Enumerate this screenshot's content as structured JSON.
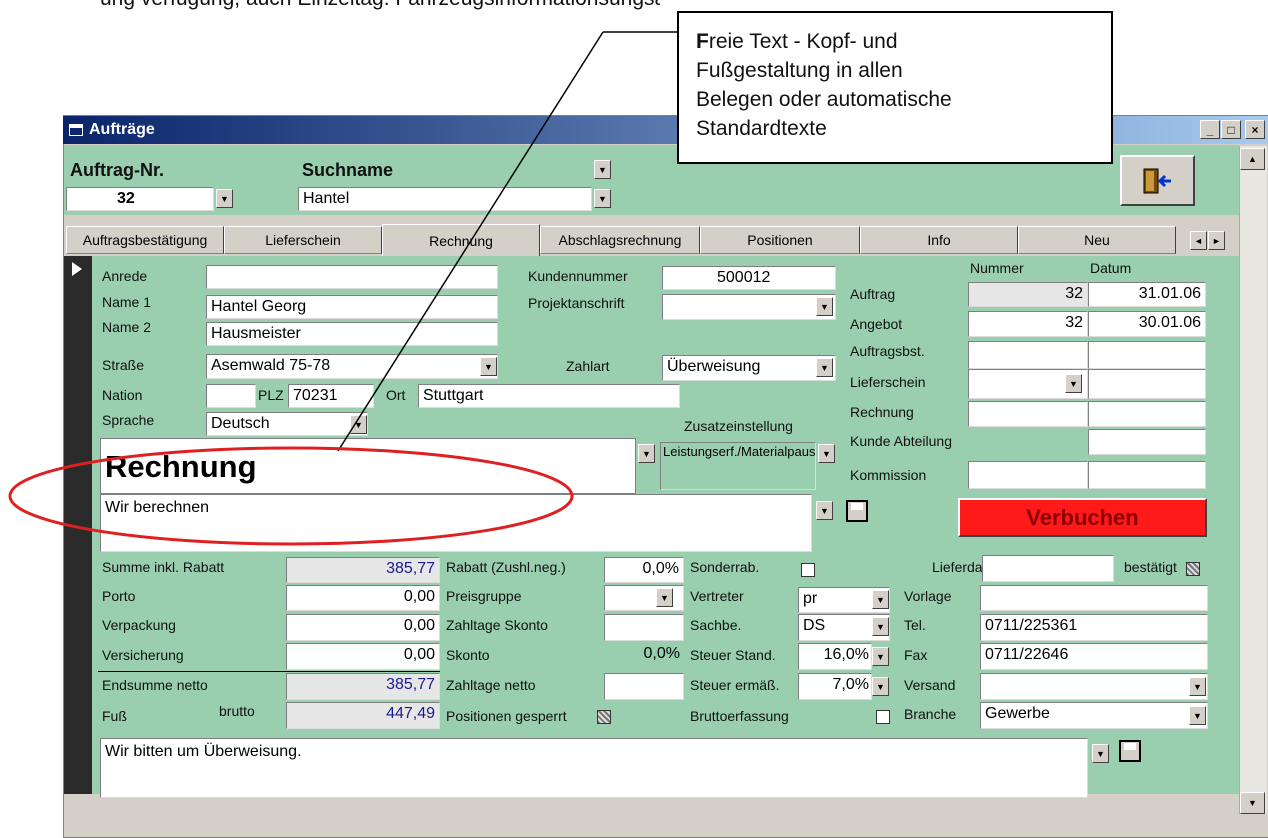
{
  "top_text": "ung verfügung, auch Einzeltag. Fahrzeugsinformationsungsaber.",
  "callout": {
    "first_letter": "F",
    "line1": "reie Text - Kopf- und",
    "line2": "Fußgestaltung in allen",
    "line3": "Belegen oder automatische",
    "line4": "Standardtexte"
  },
  "window": {
    "title": "Aufträge",
    "min": "_",
    "max": "□",
    "close": "×",
    "exit_icon": "exit-door-icon"
  },
  "header": {
    "order_label": "Auftrag-Nr.",
    "order_value": "32",
    "search_label": "Suchname",
    "search_value": "Hantel"
  },
  "tabs": [
    "Auftragsbestätigung",
    "Lieferschein",
    "Rechnung",
    "Abschlagsrechnung",
    "Positionen",
    "Info",
    "Neu"
  ],
  "tab_nav": {
    "left": "◄",
    "right": "►"
  },
  "customer": {
    "anrede_label": "Anrede",
    "anrede_value": "",
    "name1_label": "Name 1",
    "name1_value": "Hantel Georg",
    "name2_label": "Name 2",
    "name2_value": "Hausmeister",
    "strasse_label": "Straße",
    "strasse_value": "Asemwald 75-78",
    "nation_label": "Nation",
    "nation_value": "",
    "plz_label": "PLZ",
    "plz_value": "70231",
    "ort_label": "Ort",
    "ort_value": "Stuttgart",
    "sprache_label": "Sprache",
    "sprache_value": "Deutsch"
  },
  "middle": {
    "kundennummer_label": "Kundennummer",
    "kundennummer_value": "500012",
    "projekt_label": "Projektanschrift",
    "projekt_value": "",
    "zahlart_label": "Zahlart",
    "zahlart_value": "Überweisung",
    "zusatz_label": "Zusatzeinstellung",
    "zusatz_value": "Leistungserf./Materialpauschalverbuchung"
  },
  "docs": {
    "nummer_header": "Nummer",
    "datum_header": "Datum",
    "rows": [
      {
        "label": "Auftrag",
        "nummer": "32",
        "datum": "31.01.06"
      },
      {
        "label": "Angebot",
        "nummer": "32",
        "datum": "30.01.06"
      },
      {
        "label": "Auftragsbst.",
        "nummer": "",
        "datum": ""
      },
      {
        "label": "Lieferschein",
        "nummer": "",
        "datum": ""
      },
      {
        "label": "Rechnung",
        "nummer": "",
        "datum": ""
      },
      {
        "label": "Kunde Abteilung",
        "nummer": "",
        "datum": ""
      },
      {
        "label": "Kommission",
        "nummer": "",
        "datum": ""
      }
    ]
  },
  "head_text": {
    "title": "Rechnung",
    "body": "Wir berechnen"
  },
  "verbuchen": "Verbuchen",
  "totals": {
    "summe_label": "Summe inkl. Rabatt",
    "summe_value": "385,77",
    "porto_label": "Porto",
    "porto_value": "0,00",
    "verpackung_label": "Verpackung",
    "verpackung_value": "0,00",
    "versicherung_label": "Versicherung",
    "versicherung_value": "0,00",
    "endsumme_label": "Endsumme netto",
    "endsumme_value": "385,77",
    "fuss_label": "Fuß",
    "brutto_label": "brutto",
    "brutto_value": "447,49"
  },
  "terms": {
    "rabatt_label": "Rabatt (Zushl.neg.)",
    "rabatt_value": "0,0%",
    "preisgruppe_label": "Preisgruppe",
    "preisgruppe_value": "",
    "zahltage_skonto_label": "Zahltage Skonto",
    "zahltage_skonto_value": "",
    "skonto_label": "Skonto",
    "skonto_value": "0,0%",
    "zahltage_netto_label": "Zahltage netto",
    "zahltage_netto_value": "",
    "positionen_label": "Positionen gesperrt"
  },
  "agents": {
    "sonderrab_label": "Sonderrab.",
    "vertreter_label": "Vertreter",
    "vertreter_value": "pr",
    "sachbe_label": "Sachbe.",
    "sachbe_value": "DS",
    "steuer_stand_label": "Steuer Stand.",
    "steuer_stand_value": "16,0%",
    "steuer_erm_label": "Steuer ermäß.",
    "steuer_erm_value": "7,0%",
    "brutto_erf_label": "Bruttoerfassung"
  },
  "delivery": {
    "lieferdat_label": "Lieferdat.",
    "lieferdat_value": "",
    "bestaetigt_label": "bestätigt",
    "vorlage_label": "Vorlage",
    "vorlage_value": "",
    "tel_label": "Tel.",
    "tel_value": "0711/225361",
    "fax_label": "Fax",
    "fax_value": "0711/22646",
    "versand_label": "Versand",
    "versand_value": "",
    "branche_label": "Branche",
    "branche_value": "Gewerbe"
  },
  "footer_text": "Wir bitten um Überweisung.",
  "colors": {
    "form_bg": "#99cfaf",
    "title_start": "#0a246a",
    "title_end": "#a6caf0",
    "verbuchen_bg": "#ff1a1a",
    "ellipse": "#e02020"
  }
}
